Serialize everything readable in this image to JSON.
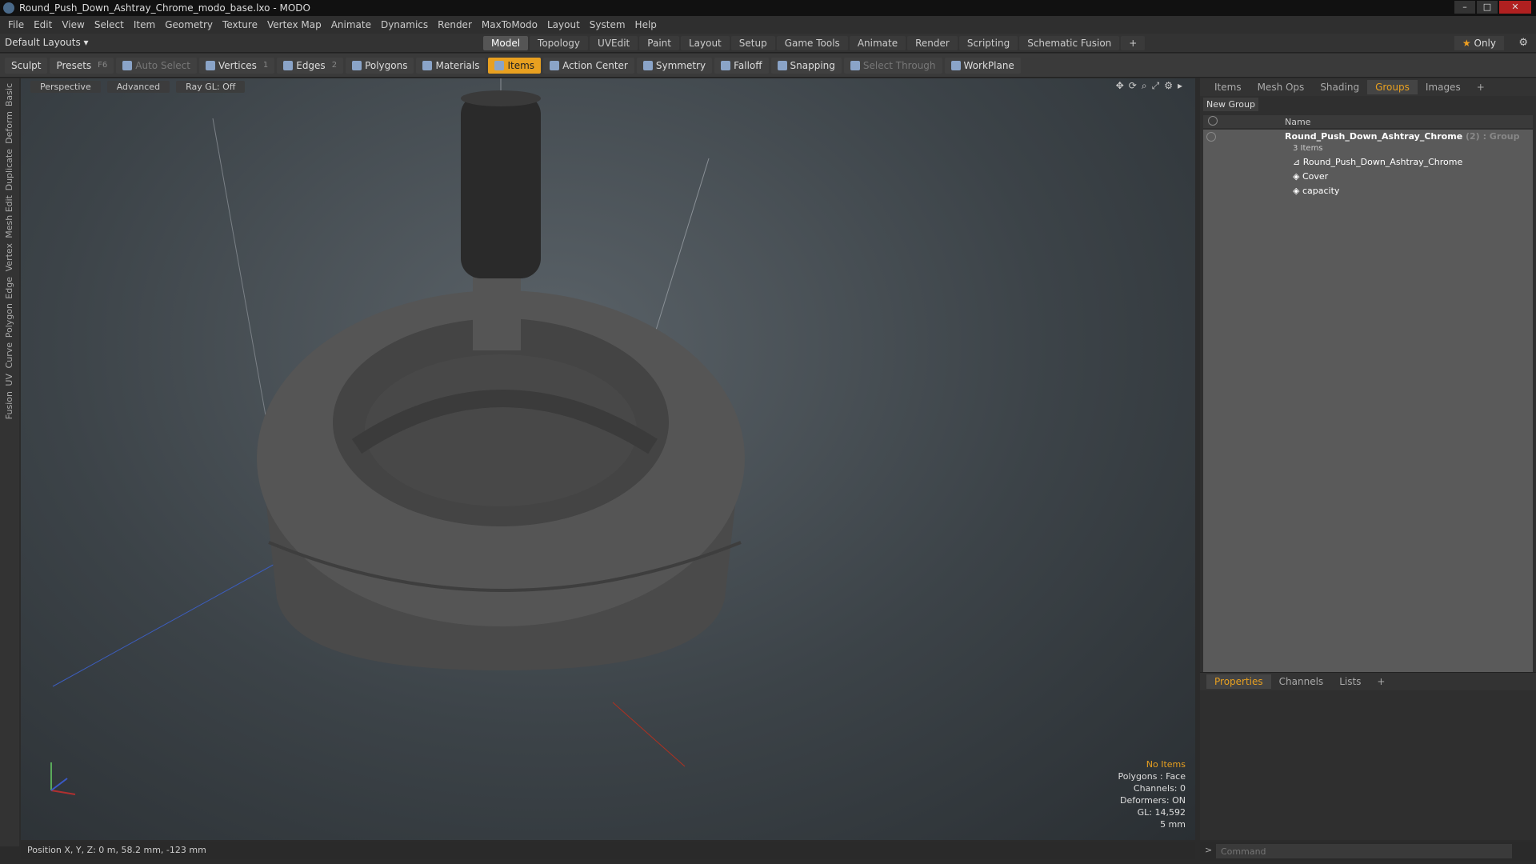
{
  "window": {
    "title": "Round_Push_Down_Ashtray_Chrome_modo_base.lxo - MODO"
  },
  "menu": [
    "File",
    "Edit",
    "View",
    "Select",
    "Item",
    "Geometry",
    "Texture",
    "Vertex Map",
    "Animate",
    "Dynamics",
    "Render",
    "MaxToModo",
    "Layout",
    "System",
    "Help"
  ],
  "layout": {
    "default": "Default Layouts",
    "tabs": [
      "Model",
      "Topology",
      "UVEdit",
      "Paint",
      "Layout",
      "Setup",
      "Game Tools",
      "Animate",
      "Render",
      "Scripting",
      "Schematic Fusion"
    ],
    "active_tab": "Model",
    "only": "Only"
  },
  "toolbar": {
    "sculpt": "Sculpt",
    "presets": "Presets",
    "presets_key": "F6",
    "auto_select": "Auto Select",
    "vertices": "Vertices",
    "vertices_count": "1",
    "edges": "Edges",
    "edges_count": "2",
    "polygons": "Polygons",
    "materials": "Materials",
    "items": "Items",
    "action_center": "Action Center",
    "symmetry": "Symmetry",
    "falloff": "Falloff",
    "snapping": "Snapping",
    "select_through": "Select Through",
    "workplane": "WorkPlane"
  },
  "left_tabs": [
    "Basic",
    "Deform",
    "Duplicate",
    "Mesh Edit",
    "Vertex",
    "Edge",
    "Polygon",
    "Curve",
    "UV",
    "Fusion"
  ],
  "viewport": {
    "view": "Perspective",
    "advanced": "Advanced",
    "raygl": "Ray GL: Off",
    "stats": {
      "no_items": "No Items",
      "polygons": "Polygons : Face",
      "channels": "Channels: 0",
      "deformers": "Deformers: ON",
      "gl": "GL: 14,592",
      "scale": "5 mm"
    }
  },
  "status": {
    "position": "Position X, Y, Z:  0 m, 58.2 mm, -123 mm"
  },
  "right_panel": {
    "tabs": [
      "Items",
      "Mesh Ops",
      "Shading",
      "Groups",
      "Images"
    ],
    "active_tab": "Groups",
    "new_group": "New Group",
    "name_header": "Name",
    "group": {
      "name": "Round_Push_Down_Ashtray_Chrome",
      "count": "(2)",
      "type": ": Group",
      "items_label": "3 Items",
      "children": [
        "Round_Push_Down_Ashtray_Chrome",
        "Cover",
        "capacity"
      ]
    },
    "bottom_tabs": [
      "Properties",
      "Channels",
      "Lists"
    ],
    "bottom_active": "Properties"
  },
  "command": {
    "placeholder": "Command"
  }
}
